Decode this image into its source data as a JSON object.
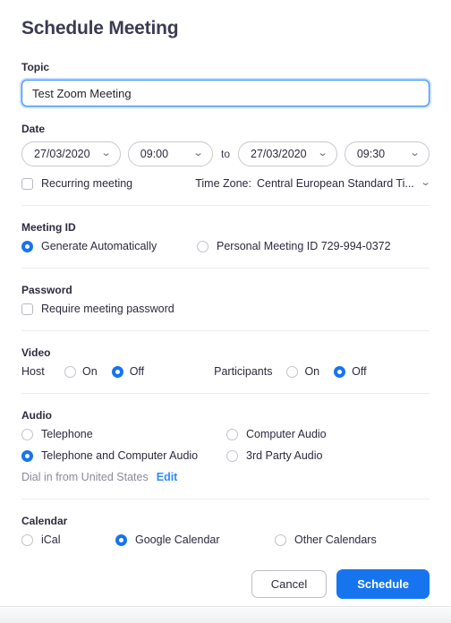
{
  "dialog": {
    "title": "Schedule Meeting"
  },
  "topic": {
    "label": "Topic",
    "value": "Test Zoom Meeting",
    "placeholder": "Topic"
  },
  "date": {
    "label": "Date",
    "start_date": "27/03/2020",
    "start_time": "09:00",
    "to_label": "to",
    "end_date": "27/03/2020",
    "end_time": "09:30",
    "recurring_label": "Recurring meeting",
    "recurring_checked": false,
    "timezone_label": "Time Zone:",
    "timezone_value": "Central European Standard Ti..."
  },
  "meeting_id": {
    "label": "Meeting ID",
    "options": [
      {
        "label": "Generate Automatically",
        "selected": true
      },
      {
        "label": "Personal Meeting ID 729-994-0372",
        "selected": false
      }
    ]
  },
  "password": {
    "label": "Password",
    "require_label": "Require meeting password",
    "require_checked": false
  },
  "video": {
    "label": "Video",
    "host_label": "Host",
    "participants_label": "Participants",
    "on_label": "On",
    "off_label": "Off",
    "host_value": "Off",
    "participants_value": "Off"
  },
  "audio": {
    "label": "Audio",
    "options": [
      {
        "label": "Telephone",
        "selected": false
      },
      {
        "label": "Computer Audio",
        "selected": false
      },
      {
        "label": "Telephone and Computer Audio",
        "selected": true
      },
      {
        "label": "3rd Party Audio",
        "selected": false
      }
    ],
    "dial_in_text": "Dial in from United States",
    "edit_label": "Edit"
  },
  "calendar": {
    "label": "Calendar",
    "options": [
      {
        "label": "iCal",
        "selected": false
      },
      {
        "label": "Google Calendar",
        "selected": true
      },
      {
        "label": "Other Calendars",
        "selected": false
      }
    ]
  },
  "buttons": {
    "cancel_label": "Cancel",
    "schedule_label": "Schedule"
  },
  "icons": {
    "chevron_down": "⌄"
  },
  "colors": {
    "accent_blue": "#1675ee",
    "focus_blue": "#2d8cff",
    "link_blue": "#2d8cff",
    "title_navy": "#3b3b52",
    "divider_gray": "#ededf1"
  }
}
